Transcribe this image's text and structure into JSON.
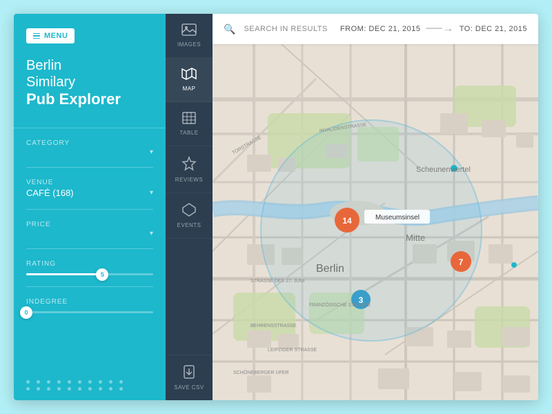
{
  "app": {
    "title_line1": "Berlin",
    "title_line2": "Similary",
    "title_line3": "Pub Explorer"
  },
  "menu": {
    "label": "MENU"
  },
  "filters": {
    "category_label": "CATEGORY",
    "category_value": "",
    "venue_label": "VENUE",
    "venue_value": "CAFÉ (168)",
    "price_label": "PRICE",
    "price_value": "",
    "rating_label": "RATING",
    "rating_value": "5",
    "indegree_label": "INDEGREE",
    "indegree_value": "0"
  },
  "nav": {
    "items": [
      {
        "id": "images",
        "label": "IMAGES",
        "icon": "🖼"
      },
      {
        "id": "map",
        "label": "MAP",
        "icon": "🗺"
      },
      {
        "id": "table",
        "label": "TABLE",
        "icon": "⊞"
      },
      {
        "id": "reviews",
        "label": "REVIEWS",
        "icon": "★"
      },
      {
        "id": "events",
        "label": "EVENTS",
        "icon": "◆"
      }
    ],
    "save_csv": "SAVE CSV",
    "save_csv_icon": "⬇"
  },
  "header": {
    "search_placeholder": "SEARCH IN RESULTS",
    "from_label": "FROM: DEC 21, 2015",
    "to_label": "TO: DEC 21, 2015"
  },
  "map": {
    "clusters": [
      {
        "id": "c1",
        "count": "14",
        "color": "orange",
        "top": "225",
        "left": "195",
        "size": "34"
      },
      {
        "id": "c2",
        "count": "7",
        "color": "orange",
        "top": "285",
        "left": "360",
        "size": "30"
      },
      {
        "id": "c3",
        "count": "3",
        "color": "blue",
        "top": "340",
        "left": "215",
        "size": "28"
      }
    ],
    "overlay": {
      "top": "130",
      "left": "170",
      "size": "230"
    },
    "tooltip": {
      "text": "Museumsinsel",
      "top": "215",
      "left": "230"
    },
    "label_berlin": "Berlin",
    "label_mitte": "Mitte",
    "label_scheunenviertel": "Scheunenviertel",
    "dot1": {
      "top": "155",
      "left": "350",
      "size": "8"
    },
    "dot2": {
      "top": "310",
      "left": "435",
      "size": "7"
    }
  },
  "colors": {
    "sidebar_bg": "#1db8cc",
    "nav_bg": "#2c3e50",
    "accent_orange": "#e8673a",
    "accent_blue": "#3a8de8",
    "map_bg": "#e8e0d5"
  }
}
